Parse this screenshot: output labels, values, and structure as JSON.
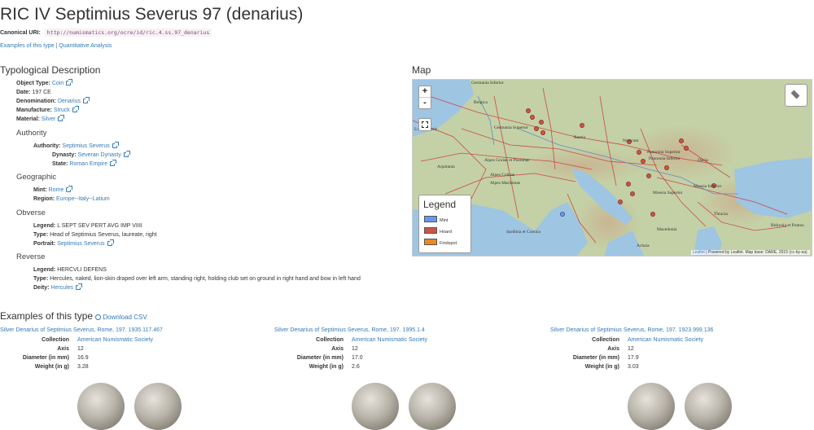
{
  "page": {
    "title": "RIC IV Septimius Severus 97 (denarius)",
    "canonical_label": "Canonical URI:",
    "canonical_uri": "http://numismatics.org/ocre/id/ric.4.ss.97_denarius",
    "links": {
      "examples": "Examples of this type",
      "separator": "|",
      "quantitative": "Quantitative Analysis"
    }
  },
  "typology": {
    "heading": "Typological Description",
    "fields": [
      {
        "label": "Object Type:",
        "value": "Coin",
        "link": true
      },
      {
        "label": "Date:",
        "value": "197 CE",
        "link": false
      },
      {
        "label": "Denomination:",
        "value": "Denarius",
        "link": true
      },
      {
        "label": "Manufacture:",
        "value": "Struck",
        "link": true
      },
      {
        "label": "Material:",
        "value": "Silver",
        "link": true
      }
    ],
    "authority": {
      "heading": "Authority",
      "fields": [
        {
          "label": "Authority:",
          "value": "Septimius Severus"
        },
        {
          "label": "Dynasty:",
          "value": "Severan Dynasty"
        },
        {
          "label": "State:",
          "value": "Roman Empire"
        }
      ]
    },
    "geographic": {
      "heading": "Geographic",
      "mint_label": "Mint:",
      "mint": "Rome",
      "region_label": "Region:",
      "region": "Europe--Italy--Latium"
    },
    "obverse": {
      "heading": "Obverse",
      "legend_label": "Legend:",
      "legend": "L SEPT SEV PERT AVG IMP VIIII",
      "type_label": "Type:",
      "type": "Head of Septimius Severus, laureate, right",
      "portrait_label": "Portrait:",
      "portrait": "Septimius Severus"
    },
    "reverse": {
      "heading": "Reverse",
      "legend_label": "Legend:",
      "legend": "HERCVLI DEFENS",
      "type_label": "Type:",
      "type": "Hercules, naked, lion-skin draped over left arm, standing right, holding club set on ground in right hand and bow in left hand",
      "deity_label": "Deity:",
      "deity": "Hercules"
    }
  },
  "map": {
    "heading": "Map",
    "zoom_in": "+",
    "zoom_out": "-",
    "legend_title": "Legend",
    "legend_items": [
      {
        "label": "Mint",
        "color": "#6699ee"
      },
      {
        "label": "Hoard",
        "color": "#cc5544"
      },
      {
        "label": "Findspot",
        "color": "#ee8822"
      }
    ],
    "attribution_leaflet": "Leaflet",
    "attribution_text": "| Powered by Leaflet. Map base: DARE, 2015 (cc-by-sa).",
    "labels": [
      "Germania Inferior",
      "Belgica",
      "Germania Superior",
      "Raetia",
      "Noricum",
      "Lugdunensis",
      "Pannonia Superior",
      "Pannonia Inferior",
      "Dacia",
      "Alpes Graiae et Poeninae",
      "Alpes Cottiae",
      "Alpes Maritimae",
      "Aquitania",
      "Moesia Superior",
      "Moesia Inferior",
      "Thracia",
      "Macedonia",
      "Sardinia et Corsica",
      "Achaia",
      "Bithynia et Pontus"
    ]
  },
  "examples": {
    "heading": "Examples of this type",
    "download": "Download CSV",
    "labels": {
      "collection": "Collection",
      "axis": "Axis",
      "diameter": "Diameter (in mm)",
      "weight": "Weight (in g)"
    },
    "items": [
      {
        "title": "Silver Denarius of Septimius Severus, Rome, 197. 1935.117.467",
        "collection": "American Numismatic Society",
        "axis": "12",
        "diameter": "16.9",
        "weight": "3.28"
      },
      {
        "title": "Silver Denarius of Septimius Severus, Rome, 197. 1995.1.4",
        "collection": "American Numismatic Society",
        "axis": "12",
        "diameter": "17.0",
        "weight": "2.6"
      },
      {
        "title": "Silver Denarius of Septimius Severus, Rome, 197. 1923.999.136",
        "collection": "American Numismatic Society",
        "axis": "12",
        "diameter": "17.9",
        "weight": "3.03"
      }
    ]
  }
}
